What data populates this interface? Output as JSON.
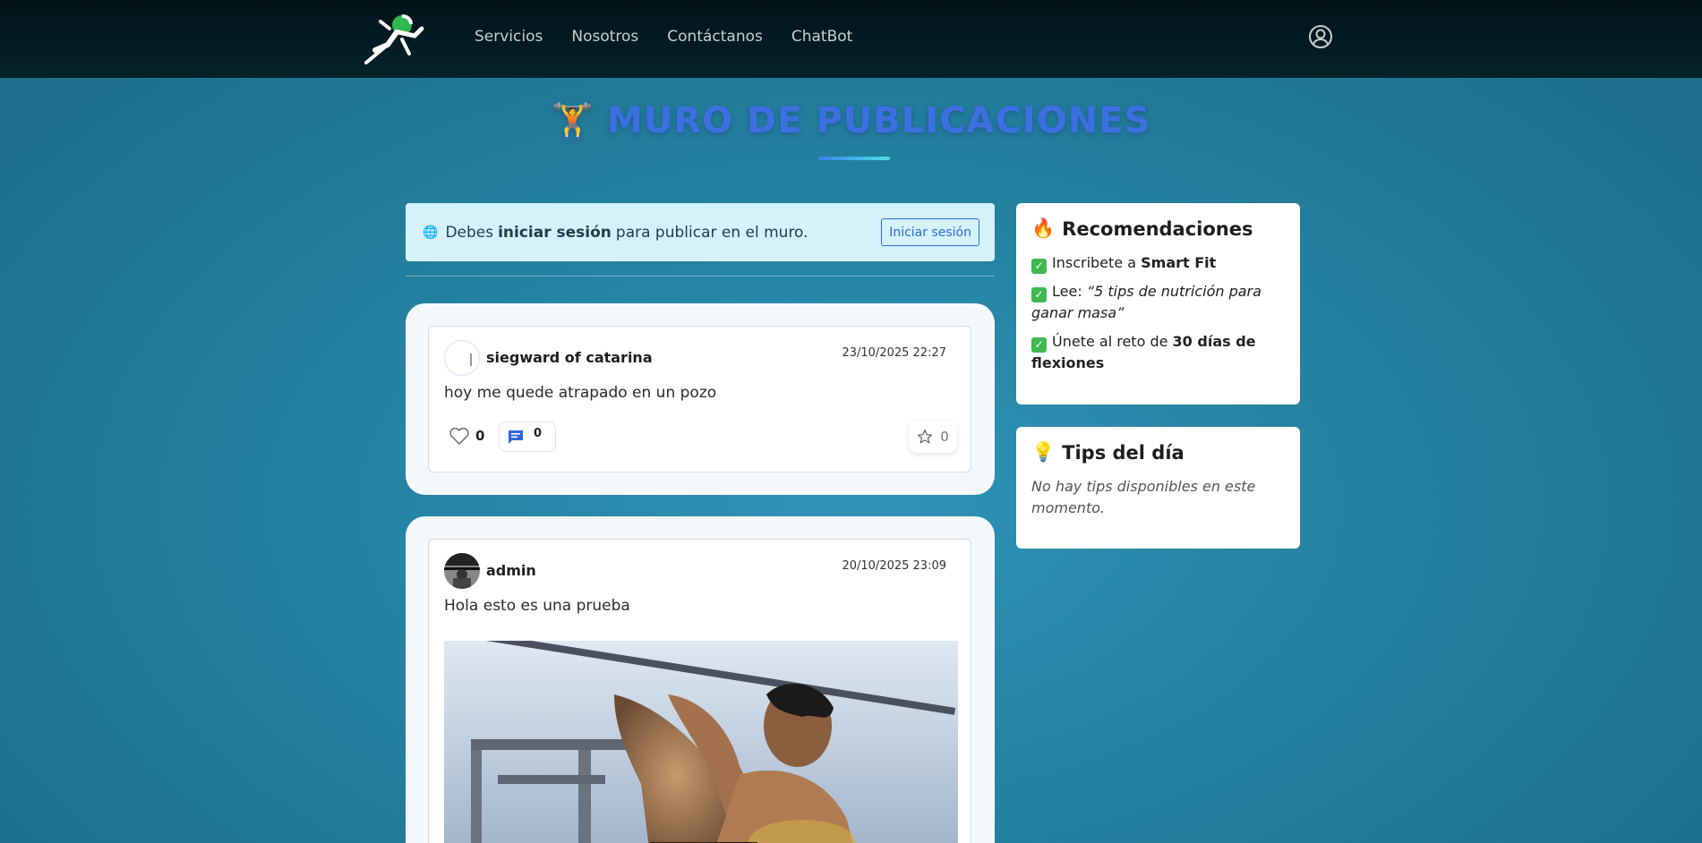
{
  "navbar": {
    "links": [
      "Servicios",
      "Nosotros",
      "Contáctanos",
      "ChatBot"
    ]
  },
  "page": {
    "title": "MURO DE PUBLICACIONES",
    "title_icon": "🏋"
  },
  "alert": {
    "prefix": "Debes",
    "bold": "iniciar sesión",
    "suffix": "para publicar en el muro.",
    "button": "Iniciar sesión"
  },
  "posts": [
    {
      "username": "siegward of catarina",
      "date": "23/10/2025 22:27",
      "content": "hoy me quede atrapado en un pozo",
      "likes": "0",
      "comments": "0",
      "favorites": "0"
    },
    {
      "username": "admin",
      "date": "20/10/2025 23:09",
      "content": "Hola esto es una prueba"
    }
  ],
  "recommendations": {
    "title": "Recomendaciones",
    "icon": "🔥",
    "item1_prefix": "Inscribete a",
    "item1_bold": "Smart Fit",
    "item2_prefix": "Lee:",
    "item2_italic": "“5 tips de nutrición para ganar masa”",
    "item3_prefix": "Únete al reto de",
    "item3_bold": "30 días de flexiones"
  },
  "tips": {
    "title": "Tips del día",
    "icon": "💡",
    "empty": "No hay tips disponibles en este momento."
  }
}
